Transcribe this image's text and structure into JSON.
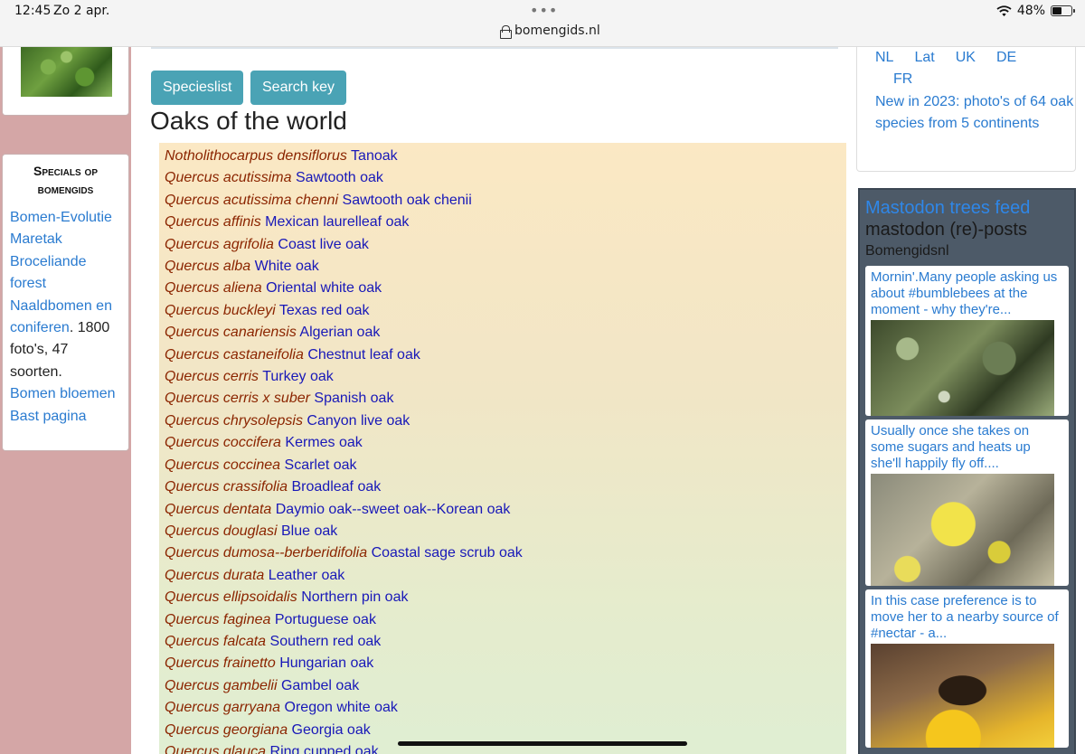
{
  "status_bar": {
    "time": "12:45",
    "date": "Zo 2 apr.",
    "dots": "•••",
    "url": "bomengids.nl",
    "battery": "48%",
    "battery_level": 0.48
  },
  "left_sidebar": {
    "specials_title": "Specials op bomengids",
    "specials_items": [
      "Bomen-Evolutie",
      "Maretak",
      "Broceliande forest",
      "Naaldbomen en coniferen"
    ],
    "specials_note": ". 1800 foto's, 47 soorten.",
    "specials_items_2": [
      "Bomen bloemen",
      "Bast pagina"
    ]
  },
  "main": {
    "buttons": {
      "specieslist": "Specieslist",
      "search_key": "Search key"
    },
    "title": "Oaks of the world",
    "species": [
      {
        "latin": "Notholithocarpus densiflorus",
        "common": "Tanoak"
      },
      {
        "latin": "Quercus acutissima",
        "common": "Sawtooth oak"
      },
      {
        "latin": "Quercus acutissima chenni",
        "common": "Sawtooth oak chenii"
      },
      {
        "latin": "Quercus affinis",
        "common": "Mexican laurelleaf oak"
      },
      {
        "latin": "Quercus agrifolia",
        "common": "Coast live oak"
      },
      {
        "latin": "Quercus alba",
        "common": "White oak"
      },
      {
        "latin": "Quercus aliena",
        "common": "Oriental white oak"
      },
      {
        "latin": "Quercus buckleyi",
        "common": "Texas red oak"
      },
      {
        "latin": "Quercus canariensis",
        "common": "Algerian oak"
      },
      {
        "latin": "Quercus castaneifolia",
        "common": "Chestnut leaf oak"
      },
      {
        "latin": "Quercus cerris",
        "common": "Turkey oak"
      },
      {
        "latin": "Quercus cerris x suber",
        "common": "Spanish oak"
      },
      {
        "latin": "Quercus chrysolepsis",
        "common": "Canyon live oak"
      },
      {
        "latin": "Quercus coccifera",
        "common": "Kermes oak"
      },
      {
        "latin": "Quercus coccinea",
        "common": "Scarlet oak"
      },
      {
        "latin": "Quercus crassifolia",
        "common": "Broadleaf oak"
      },
      {
        "latin": "Quercus dentata",
        "common": "Daymio oak--sweet oak--Korean oak"
      },
      {
        "latin": "Quercus douglasi",
        "common": "Blue oak"
      },
      {
        "latin": "Quercus dumosa--berberidifolia",
        "common": "Coastal sage scrub oak"
      },
      {
        "latin": "Quercus durata",
        "common": "Leather oak"
      },
      {
        "latin": "Quercus ellipsoidalis",
        "common": "Northern pin oak"
      },
      {
        "latin": "Quercus faginea",
        "common": "Portuguese oak"
      },
      {
        "latin": "Quercus falcata",
        "common": "Southern red oak"
      },
      {
        "latin": "Quercus frainetto",
        "common": "Hungarian oak"
      },
      {
        "latin": "Quercus gambelii",
        "common": "Gambel oak"
      },
      {
        "latin": "Quercus garryana",
        "common": "Oregon white oak"
      },
      {
        "latin": "Quercus georgiana",
        "common": "Georgia oak"
      },
      {
        "latin": "Quercus glauca",
        "common": "Ring cupped oak"
      }
    ]
  },
  "right_sidebar": {
    "languages": [
      "NL",
      "Lat",
      "UK",
      "DE",
      "FR"
    ],
    "new_note": "New in 2023: photo's of 64 oak species from 5 continents",
    "mastodon": {
      "title": "Mastodon trees feed",
      "subtitle": "mastodon (re)-posts",
      "user": "Bomengidsnl",
      "posts": [
        {
          "text": "Mornin'.Many people asking us about #bumblebees at the moment - why they're..."
        },
        {
          "text": "Usually once she takes on some sugars and heats up she'll happily fly off...."
        },
        {
          "text": "In this case preference is to move her to a nearby source of #nectar - a..."
        }
      ]
    }
  },
  "colors": {
    "button": "#4aa3b5",
    "link": "#2a7bd0",
    "latin_name": "#8b2500",
    "common_name": "#1818b8",
    "sidebar_bg": "#d4a6a6",
    "mastodon_bg": "#4d5a68"
  }
}
